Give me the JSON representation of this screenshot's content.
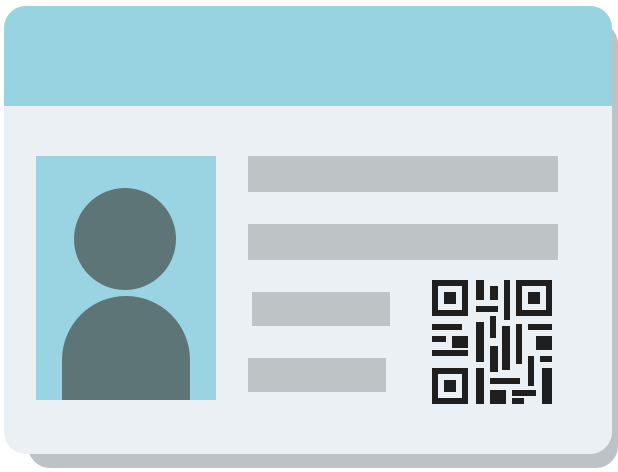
{
  "graphic": "id-card-illustration",
  "colors": {
    "header": "#97d3e1",
    "card_body": "#eaf0f3",
    "shadow": "#bcc2c6",
    "photo_background": "#9ad3e2",
    "person": "#5d7576",
    "text_bars": "#bec3c6",
    "qr_code": "#1f1f1f"
  },
  "icons": {
    "photo": "person-silhouette-icon",
    "code": "qr-code-icon"
  }
}
